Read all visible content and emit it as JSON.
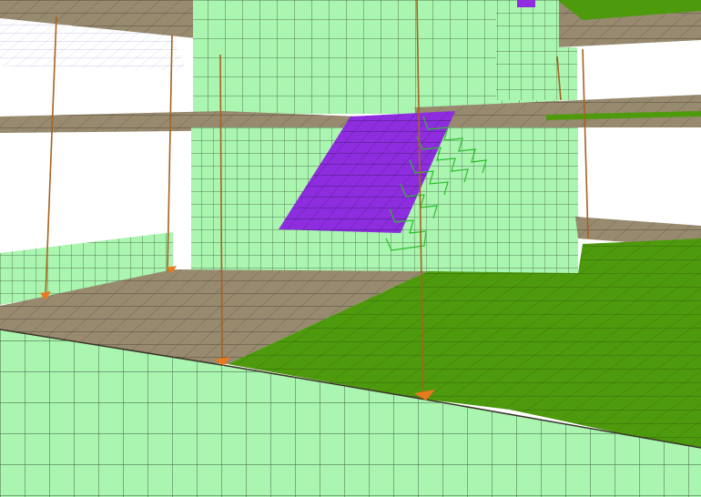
{
  "scene": {
    "colors": {
      "background": "#ffffff",
      "wall_fill": "#aaf5b0",
      "wall_mesh": "#3c5a3c",
      "slab_grey": "#978a6f",
      "slab_grey_mesh": "#3f3a2c",
      "slab_green": "#4d9a0d",
      "slab_green_mesh": "#2d4a0a",
      "beam_edge": "#3a342a",
      "stair_fill": "#8e2de0",
      "stair_mesh": "#3a1a66",
      "stair_rebar": "#2dbb2d",
      "column_line": "#a8621e",
      "support_marker": "#e77a1e",
      "far_grid": "#9aa0d6"
    }
  }
}
